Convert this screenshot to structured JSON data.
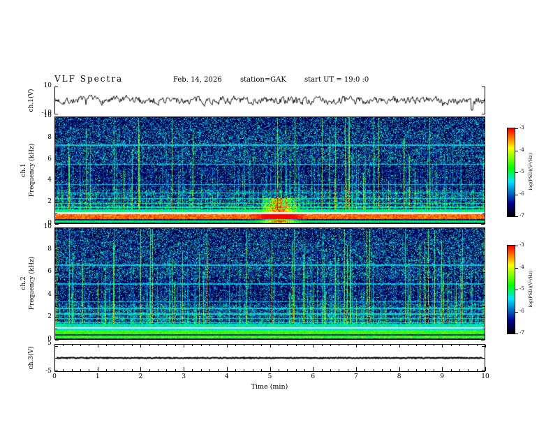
{
  "header": {
    "title": "VLF  Spectra",
    "date": "Feb. 14, 2026",
    "station": "station=GAK",
    "start_ut": "start UT =  19:0  :0"
  },
  "panels": {
    "ch1_wave": {
      "ylabel": "ch.1(V)",
      "ymax_label": "10",
      "ymin_label": "-10"
    },
    "ch1_spec": {
      "channel_label": "ch.1",
      "ylabel": "Frequency  (kHz)",
      "ytick_labels": [
        "10",
        "8",
        "6",
        "4",
        "2",
        "0"
      ]
    },
    "ch2_spec": {
      "channel_label": "ch.2",
      "ylabel": "Frequency  (kHz)",
      "ytick_labels": [
        "10",
        "8",
        "6",
        "4",
        "2",
        "0"
      ]
    },
    "ch3_wave": {
      "ylabel": "ch.3(V)",
      "ymax_label": "5",
      "ymin_label": "-5"
    }
  },
  "xaxis": {
    "label": "Time  (min)",
    "tick_labels": [
      "0",
      "1",
      "2",
      "3",
      "4",
      "5",
      "6",
      "7",
      "8",
      "9",
      "10"
    ]
  },
  "colorbar": {
    "label": "log(PSD)(V²/Hz)",
    "tick_labels": [
      "-3",
      "-4",
      "-5",
      "-6",
      "-7"
    ]
  },
  "colors": {
    "background": "#ffffff",
    "axis": "#000000",
    "colormap_stops": [
      "#000000",
      "#00008c",
      "#00e6ff",
      "#00ff40",
      "#ffff00",
      "#ff0000"
    ]
  },
  "chart_data": [
    {
      "id": "ch1_wave",
      "type": "line",
      "ylabel": "ch.1(V)",
      "xlabel": "Time (min)",
      "ylim": [
        -10,
        10
      ],
      "xlim": [
        0,
        10
      ],
      "description": "Broadband noise waveform centered on 0 V, typical excursions about ±2 V with impulsive spikes to ±5 V and one large negative spike near t ≈ 9.7 min.",
      "noise_amplitude_V": 1.6,
      "spike_x_min": 9.7,
      "spike_V": -7,
      "render": {
        "seed": 7
      }
    },
    {
      "id": "ch1_spec",
      "type": "heatmap",
      "ylabel": "Frequency (kHz)",
      "xlabel": "Time (min)",
      "xlim": [
        0,
        10
      ],
      "ylim": [
        0,
        10
      ],
      "zlabel": "log(PSD)(V²/Hz)",
      "zlim": [
        -7,
        -3
      ],
      "description": "VLF spectrogram: dense vertical sferic streaks (blue-cyan, strongest green/yellow) at all times up to ~10 kHz; intense continuous red band 0.4–0.9 kHz near −3.5; cyan-green band 0.1–0.3 kHz; saturated pale strip near 1 kHz; weak horizontal harmonic lines; localized bright low-frequency patch near t ≈ 5.2 min.",
      "render": {
        "seed": 11,
        "bands": [
          {
            "f0": 0.0,
            "f1": 0.1,
            "base": 0.12,
            "jitter": 0.15
          },
          {
            "f0": 0.1,
            "f1": 0.32,
            "base": 0.44,
            "jitter": 0.14
          },
          {
            "f0": 0.32,
            "f1": 0.42,
            "base": 0.1,
            "jitter": 0.12
          },
          {
            "f0": 0.42,
            "f1": 0.92,
            "base": 0.82,
            "jitter": 0.18
          },
          {
            "f0": 0.92,
            "f1": 1.08,
            "white": true
          },
          {
            "f0": 1.08,
            "f1": 1.35,
            "base": 0.34,
            "jitter": 0.26
          }
        ],
        "lines": [
          {
            "f": 1.55,
            "v": 0.4
          },
          {
            "f": 1.9,
            "v": 0.42
          },
          {
            "f": 2.35,
            "v": 0.36
          },
          {
            "f": 2.9,
            "v": 0.33
          },
          {
            "f": 3.7,
            "v": 0.3
          },
          {
            "f": 5.6,
            "v": 0.3
          },
          {
            "f": 7.4,
            "v": 0.32
          }
        ],
        "hot_spot_x": 5.2
      }
    },
    {
      "id": "ch2_spec",
      "type": "heatmap",
      "ylabel": "Frequency (kHz)",
      "xlabel": "Time (min)",
      "xlim": [
        0,
        10
      ],
      "ylim": [
        0,
        10
      ],
      "zlabel": "log(PSD)(V²/Hz)",
      "zlim": [
        -7,
        -3
      ],
      "description": "VLF spectrogram like ch.1 but without the intense red band: green/cyan bands below ~0.8 kHz with yellow flecks, pale strip near 1 kHz, dense blue sferic streak texture up to 10 kHz with occasional strong green/yellow/red streaks.",
      "render": {
        "seed": 23,
        "bands": [
          {
            "f0": 0.0,
            "f1": 0.1,
            "base": 0.12,
            "jitter": 0.15
          },
          {
            "f0": 0.1,
            "f1": 0.33,
            "base": 0.5,
            "jitter": 0.2
          },
          {
            "f0": 0.33,
            "f1": 0.45,
            "base": 0.12,
            "jitter": 0.12
          },
          {
            "f0": 0.45,
            "f1": 0.78,
            "base": 0.52,
            "jitter": 0.16
          },
          {
            "f0": 0.78,
            "f1": 0.95,
            "base": 0.36,
            "jitter": 0.12
          },
          {
            "f0": 0.95,
            "f1": 1.1,
            "white": true
          },
          {
            "f0": 1.1,
            "f1": 1.4,
            "base": 0.32,
            "jitter": 0.22
          }
        ],
        "lines": [
          {
            "f": 1.5,
            "v": 0.38
          },
          {
            "f": 1.9,
            "v": 0.4
          },
          {
            "f": 2.3,
            "v": 0.35
          },
          {
            "f": 2.8,
            "v": 0.32
          },
          {
            "f": 3.4,
            "v": 0.3
          },
          {
            "f": 5.0,
            "v": 0.29
          },
          {
            "f": 6.7,
            "v": 0.31
          }
        ]
      }
    },
    {
      "id": "ch3_wave",
      "type": "line",
      "ylabel": "ch.3(V)",
      "xlabel": "Time (min)",
      "ylim": [
        -5,
        5
      ],
      "xlim": [
        0,
        10
      ],
      "description": "Flat trace at ≈ 0 V for the whole record.",
      "value_V": 0,
      "render": {
        "seed": 31
      }
    }
  ]
}
